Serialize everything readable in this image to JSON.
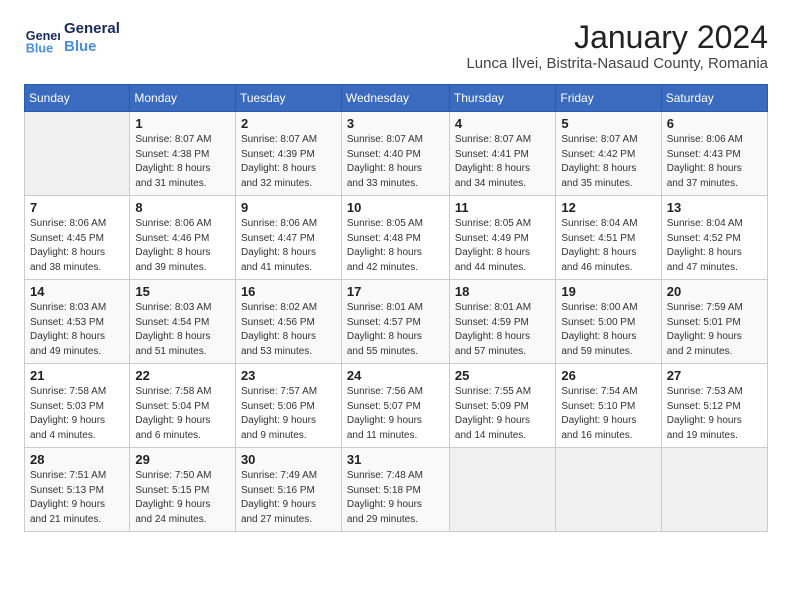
{
  "logo": {
    "line1": "General",
    "line2": "Blue"
  },
  "title": "January 2024",
  "subtitle": "Lunca Ilvei, Bistrita-Nasaud County, Romania",
  "days_header": [
    "Sunday",
    "Monday",
    "Tuesday",
    "Wednesday",
    "Thursday",
    "Friday",
    "Saturday"
  ],
  "weeks": [
    [
      {
        "num": "",
        "detail": ""
      },
      {
        "num": "1",
        "detail": "Sunrise: 8:07 AM\nSunset: 4:38 PM\nDaylight: 8 hours\nand 31 minutes."
      },
      {
        "num": "2",
        "detail": "Sunrise: 8:07 AM\nSunset: 4:39 PM\nDaylight: 8 hours\nand 32 minutes."
      },
      {
        "num": "3",
        "detail": "Sunrise: 8:07 AM\nSunset: 4:40 PM\nDaylight: 8 hours\nand 33 minutes."
      },
      {
        "num": "4",
        "detail": "Sunrise: 8:07 AM\nSunset: 4:41 PM\nDaylight: 8 hours\nand 34 minutes."
      },
      {
        "num": "5",
        "detail": "Sunrise: 8:07 AM\nSunset: 4:42 PM\nDaylight: 8 hours\nand 35 minutes."
      },
      {
        "num": "6",
        "detail": "Sunrise: 8:06 AM\nSunset: 4:43 PM\nDaylight: 8 hours\nand 37 minutes."
      }
    ],
    [
      {
        "num": "7",
        "detail": "Sunrise: 8:06 AM\nSunset: 4:45 PM\nDaylight: 8 hours\nand 38 minutes."
      },
      {
        "num": "8",
        "detail": "Sunrise: 8:06 AM\nSunset: 4:46 PM\nDaylight: 8 hours\nand 39 minutes."
      },
      {
        "num": "9",
        "detail": "Sunrise: 8:06 AM\nSunset: 4:47 PM\nDaylight: 8 hours\nand 41 minutes."
      },
      {
        "num": "10",
        "detail": "Sunrise: 8:05 AM\nSunset: 4:48 PM\nDaylight: 8 hours\nand 42 minutes."
      },
      {
        "num": "11",
        "detail": "Sunrise: 8:05 AM\nSunset: 4:49 PM\nDaylight: 8 hours\nand 44 minutes."
      },
      {
        "num": "12",
        "detail": "Sunrise: 8:04 AM\nSunset: 4:51 PM\nDaylight: 8 hours\nand 46 minutes."
      },
      {
        "num": "13",
        "detail": "Sunrise: 8:04 AM\nSunset: 4:52 PM\nDaylight: 8 hours\nand 47 minutes."
      }
    ],
    [
      {
        "num": "14",
        "detail": "Sunrise: 8:03 AM\nSunset: 4:53 PM\nDaylight: 8 hours\nand 49 minutes."
      },
      {
        "num": "15",
        "detail": "Sunrise: 8:03 AM\nSunset: 4:54 PM\nDaylight: 8 hours\nand 51 minutes."
      },
      {
        "num": "16",
        "detail": "Sunrise: 8:02 AM\nSunset: 4:56 PM\nDaylight: 8 hours\nand 53 minutes."
      },
      {
        "num": "17",
        "detail": "Sunrise: 8:01 AM\nSunset: 4:57 PM\nDaylight: 8 hours\nand 55 minutes."
      },
      {
        "num": "18",
        "detail": "Sunrise: 8:01 AM\nSunset: 4:59 PM\nDaylight: 8 hours\nand 57 minutes."
      },
      {
        "num": "19",
        "detail": "Sunrise: 8:00 AM\nSunset: 5:00 PM\nDaylight: 8 hours\nand 59 minutes."
      },
      {
        "num": "20",
        "detail": "Sunrise: 7:59 AM\nSunset: 5:01 PM\nDaylight: 9 hours\nand 2 minutes."
      }
    ],
    [
      {
        "num": "21",
        "detail": "Sunrise: 7:58 AM\nSunset: 5:03 PM\nDaylight: 9 hours\nand 4 minutes."
      },
      {
        "num": "22",
        "detail": "Sunrise: 7:58 AM\nSunset: 5:04 PM\nDaylight: 9 hours\nand 6 minutes."
      },
      {
        "num": "23",
        "detail": "Sunrise: 7:57 AM\nSunset: 5:06 PM\nDaylight: 9 hours\nand 9 minutes."
      },
      {
        "num": "24",
        "detail": "Sunrise: 7:56 AM\nSunset: 5:07 PM\nDaylight: 9 hours\nand 11 minutes."
      },
      {
        "num": "25",
        "detail": "Sunrise: 7:55 AM\nSunset: 5:09 PM\nDaylight: 9 hours\nand 14 minutes."
      },
      {
        "num": "26",
        "detail": "Sunrise: 7:54 AM\nSunset: 5:10 PM\nDaylight: 9 hours\nand 16 minutes."
      },
      {
        "num": "27",
        "detail": "Sunrise: 7:53 AM\nSunset: 5:12 PM\nDaylight: 9 hours\nand 19 minutes."
      }
    ],
    [
      {
        "num": "28",
        "detail": "Sunrise: 7:51 AM\nSunset: 5:13 PM\nDaylight: 9 hours\nand 21 minutes."
      },
      {
        "num": "29",
        "detail": "Sunrise: 7:50 AM\nSunset: 5:15 PM\nDaylight: 9 hours\nand 24 minutes."
      },
      {
        "num": "30",
        "detail": "Sunrise: 7:49 AM\nSunset: 5:16 PM\nDaylight: 9 hours\nand 27 minutes."
      },
      {
        "num": "31",
        "detail": "Sunrise: 7:48 AM\nSunset: 5:18 PM\nDaylight: 9 hours\nand 29 minutes."
      },
      {
        "num": "",
        "detail": ""
      },
      {
        "num": "",
        "detail": ""
      },
      {
        "num": "",
        "detail": ""
      }
    ]
  ]
}
